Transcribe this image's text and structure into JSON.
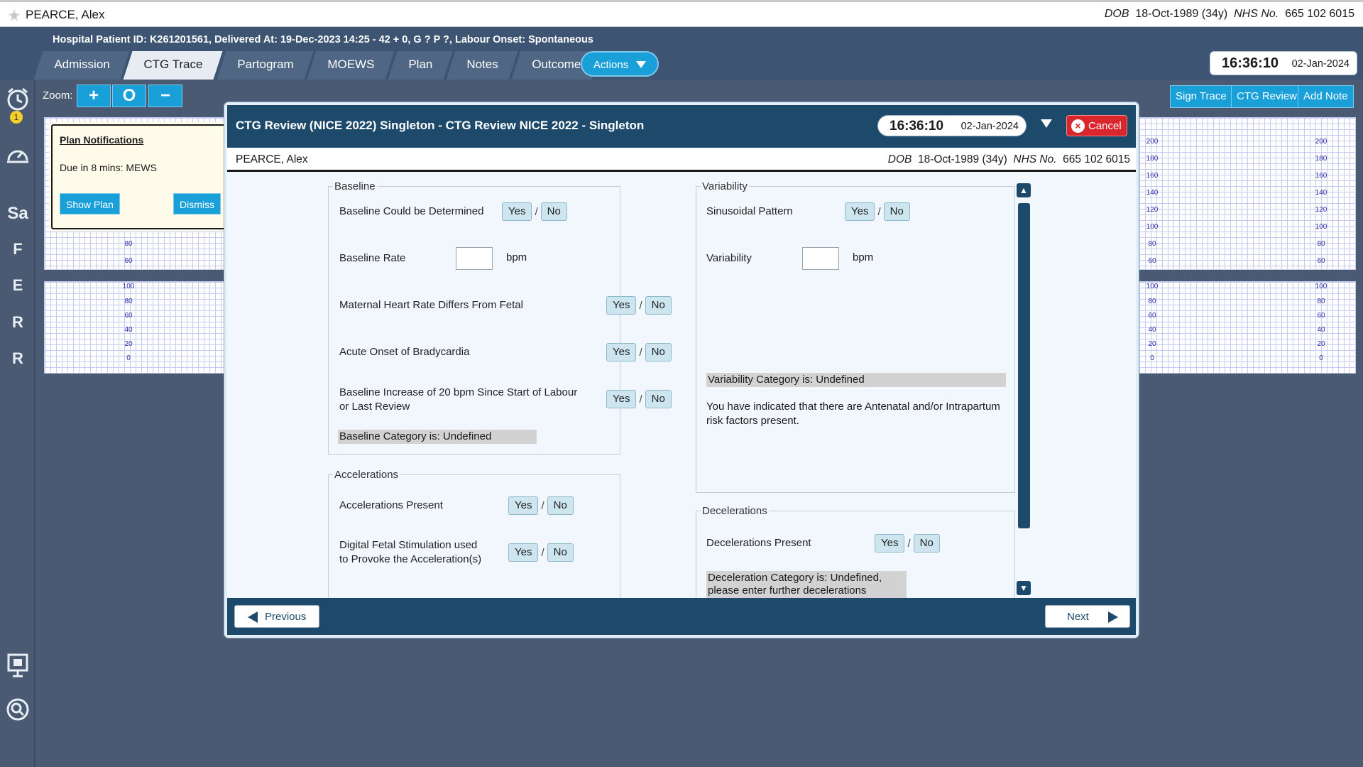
{
  "patient": {
    "name": "PEARCE, Alex",
    "dob_label": "DOB",
    "dob": "18-Oct-1989 (34y)",
    "nhs_label": "NHS No.",
    "nhs": "665 102 6015"
  },
  "header": {
    "info": "Hospital Patient ID: K261201561, Delivered At: 19-Dec-2023 14:25 - 42 + 0, G ? P ?,   Labour Onset: Spontaneous",
    "tabs": [
      "Admission",
      "CTG Trace",
      "Partogram",
      "MOEWS",
      "Plan",
      "Notes",
      "Outcome"
    ],
    "active_tab": "CTG Trace",
    "actions_label": "Actions",
    "time": "16:36:10",
    "date": "02-Jan-2024"
  },
  "rail": {
    "badge": "1",
    "letters": [
      "Sa",
      "F",
      "E",
      "R",
      "R"
    ]
  },
  "toolbar": {
    "zoom_label": "Zoom:",
    "zoom_in": "+",
    "zoom_reset": "O",
    "zoom_out": "−",
    "sign_trace": "Sign Trace",
    "ctg_review": "CTG Review",
    "add_note": "Add Note"
  },
  "trace_labels": {
    "fhr": [
      "200",
      "180",
      "160",
      "140",
      "120",
      "100",
      "80",
      "60"
    ],
    "toco": [
      "100",
      "80",
      "60",
      "40",
      "20",
      "0"
    ]
  },
  "plan_notification": {
    "title": "Plan Notifications",
    "due": "Due in 8 mins: MEWS",
    "show_plan": "Show Plan",
    "dismiss": "Dismiss"
  },
  "modal": {
    "title": "CTG Review (NICE 2022) Singleton - CTG Review NICE 2022 - Singleton",
    "time": "16:36:10",
    "date": "02-Jan-2024",
    "cancel": "Cancel",
    "previous": "Previous",
    "next": "Next",
    "yes": "Yes",
    "no": "No",
    "slash": "/",
    "bpm": "bpm",
    "baseline": {
      "legend": "Baseline",
      "q_determined": "Baseline Could be Determined",
      "q_rate": "Baseline Rate",
      "q_maternal": "Maternal Heart Rate Differs From Fetal",
      "q_bradycardia": "Acute Onset of Bradycardia",
      "q_increase": "Baseline Increase of 20 bpm Since Start of Labour or Last Review",
      "category": "Baseline Category is: Undefined"
    },
    "accelerations": {
      "legend": "Accelerations",
      "q_present": "Accelerations Present",
      "q_digital": "Digital Fetal Stimulation used to Provoke the Acceleration(s)"
    },
    "variability": {
      "legend": "Variability",
      "q_sinusoidal": "Sinusoidal Pattern",
      "q_variability": "Variability",
      "category": "Variability Category is: Undefined",
      "note": "You have indicated that there are Antenatal and/or Intrapartum risk factors present."
    },
    "decelerations": {
      "legend": "Decelerations",
      "q_present": "Decelerations Present",
      "category": "Deceleration Category is: Undefined, please enter further decelerations"
    }
  }
}
